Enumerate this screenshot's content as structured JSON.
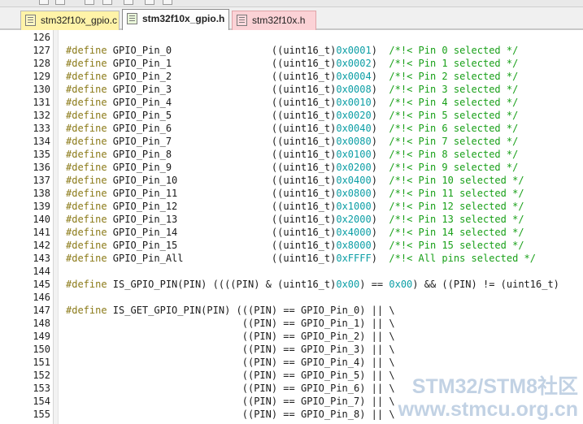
{
  "tabs": [
    {
      "label": "stm32f10x_gpio.c",
      "active": false
    },
    {
      "label": "stm32f10x_gpio.h",
      "active": true
    },
    {
      "label": "stm32f10x.h",
      "active": false
    }
  ],
  "toolbar": {
    "icons": [
      "dropdown-icon",
      "cut-icon",
      "paste-icon",
      "copy-icon",
      "find-icon",
      "check-icon"
    ]
  },
  "editor": {
    "lines": [
      {
        "n": "126",
        "parts": []
      },
      {
        "n": "127",
        "parts": [
          {
            "k": "kw",
            "t": "#define"
          },
          {
            "k": "",
            "t": " GPIO_Pin_0                 ((uint16_t)"
          },
          {
            "k": "hex",
            "t": "0x0001"
          },
          {
            "k": "",
            "t": ")  "
          },
          {
            "k": "cm",
            "t": "/*!< Pin 0 selected */"
          }
        ]
      },
      {
        "n": "128",
        "parts": [
          {
            "k": "kw",
            "t": "#define"
          },
          {
            "k": "",
            "t": " GPIO_Pin_1                 ((uint16_t)"
          },
          {
            "k": "hex",
            "t": "0x0002"
          },
          {
            "k": "",
            "t": ")  "
          },
          {
            "k": "cm",
            "t": "/*!< Pin 1 selected */"
          }
        ]
      },
      {
        "n": "129",
        "parts": [
          {
            "k": "kw",
            "t": "#define"
          },
          {
            "k": "",
            "t": " GPIO_Pin_2                 ((uint16_t)"
          },
          {
            "k": "hex",
            "t": "0x0004"
          },
          {
            "k": "",
            "t": ")  "
          },
          {
            "k": "cm",
            "t": "/*!< Pin 2 selected */"
          }
        ]
      },
      {
        "n": "130",
        "parts": [
          {
            "k": "kw",
            "t": "#define"
          },
          {
            "k": "",
            "t": " GPIO_Pin_3                 ((uint16_t)"
          },
          {
            "k": "hex",
            "t": "0x0008"
          },
          {
            "k": "",
            "t": ")  "
          },
          {
            "k": "cm",
            "t": "/*!< Pin 3 selected */"
          }
        ]
      },
      {
        "n": "131",
        "parts": [
          {
            "k": "kw",
            "t": "#define"
          },
          {
            "k": "",
            "t": " GPIO_Pin_4                 ((uint16_t)"
          },
          {
            "k": "hex",
            "t": "0x0010"
          },
          {
            "k": "",
            "t": ")  "
          },
          {
            "k": "cm",
            "t": "/*!< Pin 4 selected */"
          }
        ]
      },
      {
        "n": "132",
        "parts": [
          {
            "k": "kw",
            "t": "#define"
          },
          {
            "k": "",
            "t": " GPIO_Pin_5                 ((uint16_t)"
          },
          {
            "k": "hex",
            "t": "0x0020"
          },
          {
            "k": "",
            "t": ")  "
          },
          {
            "k": "cm",
            "t": "/*!< Pin 5 selected */"
          }
        ]
      },
      {
        "n": "133",
        "parts": [
          {
            "k": "kw",
            "t": "#define"
          },
          {
            "k": "",
            "t": " GPIO_Pin_6                 ((uint16_t)"
          },
          {
            "k": "hex",
            "t": "0x0040"
          },
          {
            "k": "",
            "t": ")  "
          },
          {
            "k": "cm",
            "t": "/*!< Pin 6 selected */"
          }
        ]
      },
      {
        "n": "134",
        "parts": [
          {
            "k": "kw",
            "t": "#define"
          },
          {
            "k": "",
            "t": " GPIO_Pin_7                 ((uint16_t)"
          },
          {
            "k": "hex",
            "t": "0x0080"
          },
          {
            "k": "",
            "t": ")  "
          },
          {
            "k": "cm",
            "t": "/*!< Pin 7 selected */"
          }
        ]
      },
      {
        "n": "135",
        "parts": [
          {
            "k": "kw",
            "t": "#define"
          },
          {
            "k": "",
            "t": " GPIO_Pin_8                 ((uint16_t)"
          },
          {
            "k": "hex",
            "t": "0x0100"
          },
          {
            "k": "",
            "t": ")  "
          },
          {
            "k": "cm",
            "t": "/*!< Pin 8 selected */"
          }
        ]
      },
      {
        "n": "136",
        "parts": [
          {
            "k": "kw",
            "t": "#define"
          },
          {
            "k": "",
            "t": " GPIO_Pin_9                 ((uint16_t)"
          },
          {
            "k": "hex",
            "t": "0x0200"
          },
          {
            "k": "",
            "t": ")  "
          },
          {
            "k": "cm",
            "t": "/*!< Pin 9 selected */"
          }
        ]
      },
      {
        "n": "137",
        "parts": [
          {
            "k": "kw",
            "t": "#define"
          },
          {
            "k": "",
            "t": " GPIO_Pin_10                ((uint16_t)"
          },
          {
            "k": "hex",
            "t": "0x0400"
          },
          {
            "k": "",
            "t": ")  "
          },
          {
            "k": "cm",
            "t": "/*!< Pin 10 selected */"
          }
        ]
      },
      {
        "n": "138",
        "parts": [
          {
            "k": "kw",
            "t": "#define"
          },
          {
            "k": "",
            "t": " GPIO_Pin_11                ((uint16_t)"
          },
          {
            "k": "hex",
            "t": "0x0800"
          },
          {
            "k": "",
            "t": ")  "
          },
          {
            "k": "cm",
            "t": "/*!< Pin 11 selected */"
          }
        ]
      },
      {
        "n": "139",
        "parts": [
          {
            "k": "kw",
            "t": "#define"
          },
          {
            "k": "",
            "t": " GPIO_Pin_12                ((uint16_t)"
          },
          {
            "k": "hex",
            "t": "0x1000"
          },
          {
            "k": "",
            "t": ")  "
          },
          {
            "k": "cm",
            "t": "/*!< Pin 12 selected */"
          }
        ]
      },
      {
        "n": "140",
        "parts": [
          {
            "k": "kw",
            "t": "#define"
          },
          {
            "k": "",
            "t": " GPIO_Pin_13                ((uint16_t)"
          },
          {
            "k": "hex",
            "t": "0x2000"
          },
          {
            "k": "",
            "t": ")  "
          },
          {
            "k": "cm",
            "t": "/*!< Pin 13 selected */"
          }
        ]
      },
      {
        "n": "141",
        "parts": [
          {
            "k": "kw",
            "t": "#define"
          },
          {
            "k": "",
            "t": " GPIO_Pin_14                ((uint16_t)"
          },
          {
            "k": "hex",
            "t": "0x4000"
          },
          {
            "k": "",
            "t": ")  "
          },
          {
            "k": "cm",
            "t": "/*!< Pin 14 selected */"
          }
        ]
      },
      {
        "n": "142",
        "parts": [
          {
            "k": "kw",
            "t": "#define"
          },
          {
            "k": "",
            "t": " GPIO_Pin_15                ((uint16_t)"
          },
          {
            "k": "hex",
            "t": "0x8000"
          },
          {
            "k": "",
            "t": ")  "
          },
          {
            "k": "cm",
            "t": "/*!< Pin 15 selected */"
          }
        ]
      },
      {
        "n": "143",
        "parts": [
          {
            "k": "kw",
            "t": "#define"
          },
          {
            "k": "",
            "t": " GPIO_Pin_All               ((uint16_t)"
          },
          {
            "k": "hex",
            "t": "0xFFFF"
          },
          {
            "k": "",
            "t": ")  "
          },
          {
            "k": "cm",
            "t": "/*!< All pins selected */"
          }
        ]
      },
      {
        "n": "144",
        "parts": []
      },
      {
        "n": "145",
        "parts": [
          {
            "k": "kw",
            "t": "#define"
          },
          {
            "k": "",
            "t": " IS_GPIO_PIN(PIN) ((((PIN) & (uint16_t)"
          },
          {
            "k": "hex",
            "t": "0x00"
          },
          {
            "k": "",
            "t": ") == "
          },
          {
            "k": "hex",
            "t": "0x00"
          },
          {
            "k": "",
            "t": ") && ((PIN) != (uint16_t)"
          }
        ]
      },
      {
        "n": "146",
        "parts": []
      },
      {
        "n": "147",
        "parts": [
          {
            "k": "kw",
            "t": "#define"
          },
          {
            "k": "",
            "t": " IS_GET_GPIO_PIN(PIN) (((PIN) == GPIO_Pin_0) || \\"
          }
        ]
      },
      {
        "n": "148",
        "parts": [
          {
            "k": "",
            "t": "                              ((PIN) == GPIO_Pin_1) || \\"
          }
        ]
      },
      {
        "n": "149",
        "parts": [
          {
            "k": "",
            "t": "                              ((PIN) == GPIO_Pin_2) || \\"
          }
        ]
      },
      {
        "n": "150",
        "parts": [
          {
            "k": "",
            "t": "                              ((PIN) == GPIO_Pin_3) || \\"
          }
        ]
      },
      {
        "n": "151",
        "parts": [
          {
            "k": "",
            "t": "                              ((PIN) == GPIO_Pin_4) || \\"
          }
        ]
      },
      {
        "n": "152",
        "parts": [
          {
            "k": "",
            "t": "                              ((PIN) == GPIO_Pin_5) || \\"
          }
        ]
      },
      {
        "n": "153",
        "parts": [
          {
            "k": "",
            "t": "                              ((PIN) == GPIO_Pin_6) || \\"
          }
        ]
      },
      {
        "n": "154",
        "parts": [
          {
            "k": "",
            "t": "                              ((PIN) == GPIO_Pin_7) || \\"
          }
        ]
      },
      {
        "n": "155",
        "parts": [
          {
            "k": "",
            "t": "                              ((PIN) == GPIO_Pin_8) || \\"
          }
        ]
      }
    ]
  },
  "watermark": {
    "line1": "STM32/STM8社区",
    "line2": "www.stmcu.org.cn"
  },
  "colors": {
    "keyword": "#8b7a18",
    "hex_literal": "#0b9ea5",
    "comment": "#19a019",
    "active_tab": "#fdfdfd",
    "header_tab": "#fbd2d6"
  }
}
